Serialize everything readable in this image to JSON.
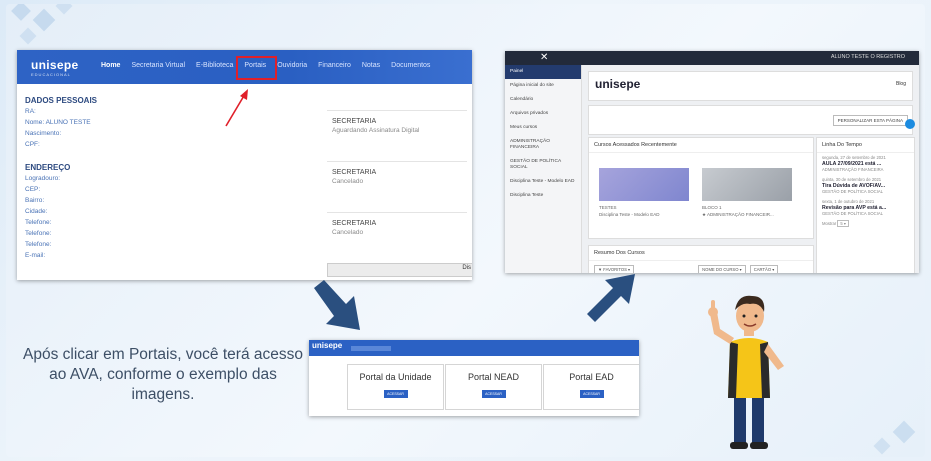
{
  "shot1": {
    "logo": "unisepe",
    "logo_sub": "EDUCACIONAL",
    "menu": [
      "Home",
      "Secretaria Virtual",
      "E-Biblioteca",
      "Portais",
      "Ouvidoria",
      "Financeiro",
      "Notas",
      "Documentos"
    ],
    "personal_header": "DADOS PESSOAIS",
    "personal_rows": [
      "RA:",
      "Nome: ALUNO TESTE",
      "Nascimento:",
      "CPF:"
    ],
    "address_header": "ENDEREÇO",
    "address_rows": [
      "Logradouro:",
      "CEP:",
      "Bairro:",
      "Cidade:",
      "Telefone:",
      "Telefone:",
      "Telefone:",
      "E-mail:"
    ],
    "cards": [
      {
        "title": "SECRETARIA",
        "status": "Aguardando Assinatura Digital"
      },
      {
        "title": "SECRETARIA",
        "status": "Cancelado"
      },
      {
        "title": "SECRETARIA",
        "status": "Cancelado"
      }
    ],
    "bottom_fragment": "Dis"
  },
  "shot2": {
    "close": "✕",
    "user": "ALUNO TESTE O REGISTRO",
    "sidebar": [
      "Painel",
      "Página inicial do site",
      "Calendário",
      "Arquivos privados",
      "Meus cursos",
      "ADMINISTRAÇÃO FINANCEIRA",
      "GESTÃO DE POLÍTICA SOCIAL",
      "Disciplina Teste - Modelo EAD",
      "Disciplina Teste"
    ],
    "logo": "unisepe",
    "blog": "Blog",
    "customize": "PERSONALIZAR ESTA PÁGINA",
    "recent_header": "Cursos Acessados Recentemente",
    "course_a": {
      "tag": "TESTES",
      "name": "Disciplina Teste - Modelo EAD"
    },
    "course_b": {
      "tag": "BLOCO 1",
      "name": "★ ADMINISTRAÇÃO FINANCEIR..."
    },
    "resumo_header": "Resumo Dos Cursos",
    "resumo_filters": [
      "▼ FAVORITOS ▾",
      "NOME DO CURSO ▾",
      "CARTÃO ▾"
    ],
    "timeline_header": "Linha Do Tempo",
    "timeline": [
      {
        "date": "segunda, 27 de setembro de 2021",
        "title": "AULA 27/09/2021 está ...",
        "course": "ADMINISTRAÇÃO FINANCEIRA"
      },
      {
        "date": "quinta, 30 de setembro de 2021",
        "title": "Tira Dúvida de AVOF/AV...",
        "course": "GESTÃO DE POLÍTICA SOCIAL"
      },
      {
        "date": "sexta, 1 de outubro de 2021",
        "title": "Revisão para AVP está a...",
        "course": "GESTÃO DE POLÍTICA SOCIAL"
      }
    ],
    "mostrar": "Mostrar",
    "mostrar_value": "5 ▾"
  },
  "caption": "Após clicar em Portais, você terá acesso ao AVA, conforme o exemplo das imagens.",
  "shot3": {
    "logo": "unisepe",
    "portals": [
      {
        "title": "Portal da Unidade",
        "btn": "ACESSAR"
      },
      {
        "title": "Portal NEAD",
        "btn": "ACESSAR"
      },
      {
        "title": "Portal EAD",
        "btn": "ACESSAR"
      }
    ]
  },
  "colors": {
    "nav_blue": "#2e63c5",
    "highlight_red": "#e0202a",
    "arrow_blue": "#2a4f7f",
    "sidebar_dark": "#233b6e"
  }
}
